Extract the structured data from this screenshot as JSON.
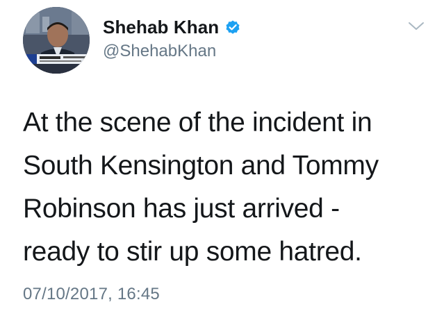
{
  "author": {
    "display_name": "Shehab Khan",
    "handle": "@ShehabKhan",
    "verified": true,
    "verified_color": "#1da1f2",
    "avatar_icon": "avatar-photo"
  },
  "menu": {
    "icon": "chevron-down-icon"
  },
  "tweet": {
    "text_lines": [
      "At the scene of the incident in",
      "South Kensington and Tommy",
      "Robinson has just arrived -",
      "ready to stir up some hatred."
    ],
    "timestamp": "07/10/2017, 16:45"
  },
  "colors": {
    "text": "#14171a",
    "secondary": "#657786",
    "background": "#ffffff"
  }
}
